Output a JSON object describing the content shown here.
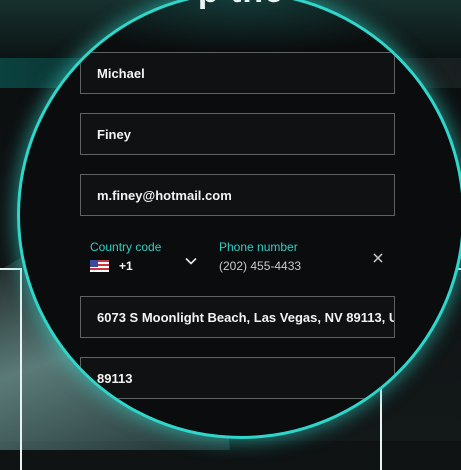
{
  "form": {
    "heading": "p the",
    "first_name": "Michael",
    "last_name": "Finey",
    "email": "m.finey@hotmail.com",
    "country_code_label": "Country code",
    "country_code_value": "+1",
    "country_flag_icon": "us-flag-icon",
    "phone_label": "Phone number",
    "phone_value": "(202) 455-4433",
    "address": "6073 S Moonlight Beach, Las Vegas, NV 89113, U",
    "zip": "89113"
  },
  "colors": {
    "accent": "#2fd6c9",
    "field_border": "#5e6264",
    "background": "#0b0c0d"
  }
}
